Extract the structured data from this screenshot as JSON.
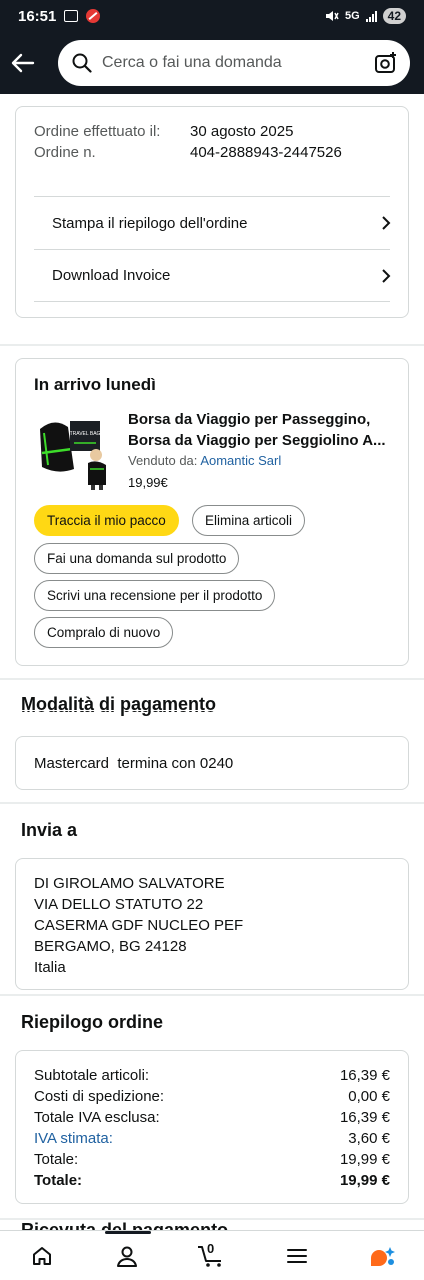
{
  "status": {
    "time": "16:51",
    "battery": "42",
    "net": "5G"
  },
  "search": {
    "placeholder": "Cerca o fai una domanda"
  },
  "order": {
    "placed_label": "Ordine effettuato il:",
    "placed_value": "30 agosto 2025",
    "number_label": "Ordine n.",
    "number_value": "404-2888943-2447526",
    "links": [
      "Stampa il riepilogo dell'ordine",
      "Download Invoice"
    ]
  },
  "shipment": {
    "heading": "In arrivo lunedì",
    "product_title_1": "Borsa da Viaggio per Passeggino,",
    "product_title_2": "Borsa da Viaggio per Seggiolino A...",
    "sold_by_label": "Venduto da:",
    "seller": "Aomantic Sarl",
    "price": "19,99€",
    "buttons": {
      "track": "Traccia il mio pacco",
      "delete": "Elimina articoli",
      "ask": "Fai una domanda sul prodotto",
      "review": "Scrivi una recensione per il prodotto",
      "rebuy": "Compralo di nuovo"
    },
    "image_text": "TRAVEL BAG"
  },
  "payment": {
    "title": "Modalità di pagamento",
    "method": "Mastercard  termina con 0240"
  },
  "shipping": {
    "title": "Invia a",
    "lines": [
      "DI GIROLAMO SALVATORE",
      "VIA DELLO STATUTO 22",
      "CASERMA GDF NUCLEO PEF",
      "BERGAMO, BG 24128",
      "Italia"
    ]
  },
  "summary": {
    "title": "Riepilogo ordine",
    "rows": [
      {
        "label": "Subtotale articoli:",
        "value": "16,39 €"
      },
      {
        "label": "Costi di spedizione:",
        "value": "0,00 €"
      },
      {
        "label": "Totale IVA esclusa:",
        "value": "16,39 €"
      },
      {
        "label": "IVA stimata:",
        "value": "3,60 €"
      },
      {
        "label": "Totale:",
        "value": "19,99 €"
      },
      {
        "label": "Totale:",
        "value": "19,99 €"
      }
    ]
  },
  "next_section": {
    "title": "Ricevuta del pagamento"
  },
  "nav": {
    "cart_count": "0"
  }
}
